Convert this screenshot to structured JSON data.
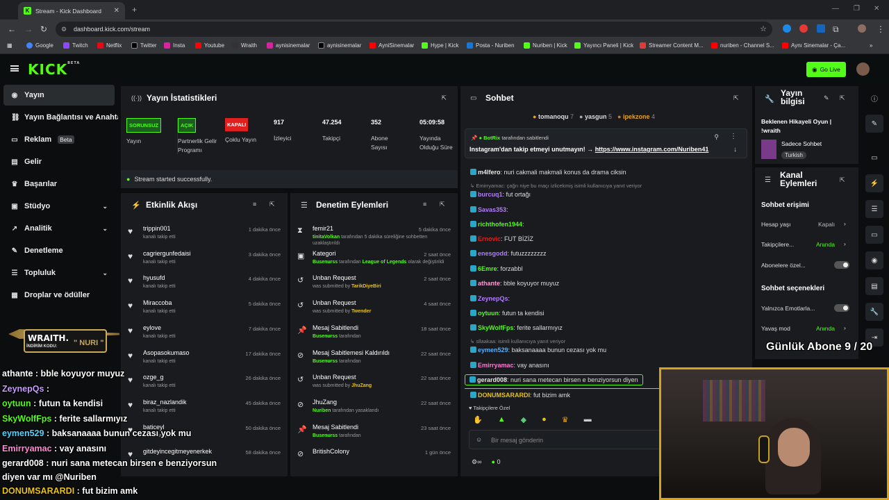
{
  "browser": {
    "tab_title": "Stream - Kick Dashboard",
    "url": "dashboard.kick.com/stream",
    "bookmarks": [
      "Google",
      "Twitch",
      "Netflix",
      "Twitter",
      "Insta",
      "Youtube",
      "Wraith",
      "aynisinemalar",
      "aynisinemalar",
      "AyniSinemalar",
      "Hype | Kick",
      "Posta - Nuriben",
      "Nuriben | Kick",
      "Yayıncı Paneli | Kick",
      "Streamer Content M...",
      "nuriben - Channel S...",
      "Aynı Sinemalar - Ça..."
    ]
  },
  "header": {
    "logo": "KICK",
    "logo_sup": "BETA",
    "go_live": "Go Live"
  },
  "sidebar": {
    "items": [
      {
        "label": "Yayın",
        "icon": "broadcast-icon"
      },
      {
        "label": "Yayın Bağlantısı ve Anahtarı",
        "icon": "link-icon"
      },
      {
        "label": "Reklam",
        "icon": "ad-icon",
        "badge": "Beta"
      },
      {
        "label": "Gelir",
        "icon": "revenue-icon"
      },
      {
        "label": "Başarılar",
        "icon": "trophy-icon"
      },
      {
        "label": "Stüdyo",
        "icon": "studio-icon"
      },
      {
        "label": "Analitik",
        "icon": "analytics-icon"
      },
      {
        "label": "Denetleme",
        "icon": "wrench-icon"
      },
      {
        "label": "Topluluk",
        "icon": "community-icon"
      },
      {
        "label": "Droplar ve ödüller",
        "icon": "gift-icon"
      }
    ]
  },
  "stats": {
    "title": "Yayın İstatistikleri",
    "badges": [
      {
        "badge": "SORUNSUZ",
        "label": "Yayın",
        "color": "#53fc18"
      },
      {
        "badge": "AÇIK",
        "label": "Partnerlik Gelir Programı",
        "color": "#53fc18"
      },
      {
        "badge": "KAPALI",
        "label": "Çoklu Yayın",
        "color": "#e0201e"
      }
    ],
    "numbers": [
      {
        "value": "917",
        "label": "İzleyici"
      },
      {
        "value": "47.254",
        "label": "Takipçi"
      },
      {
        "value": "352",
        "label": "Abone Sayısı"
      },
      {
        "value": "05:09:58",
        "label": "Yayında Olduğu Süre"
      }
    ],
    "status": "Stream started successfully."
  },
  "activity": {
    "title": "Etkinlik Akışı",
    "items": [
      {
        "name": "trippin001",
        "sub": "kanalı takip etti",
        "time": "1 dakika önce"
      },
      {
        "name": "cagriergunfedaisi",
        "sub": "kanalı takip etti",
        "time": "3 dakika önce"
      },
      {
        "name": "hyusufd",
        "sub": "kanalı takip etti",
        "time": "4 dakika önce"
      },
      {
        "name": "Miraccoba",
        "sub": "kanalı takip etti",
        "time": "5 dakika önce"
      },
      {
        "name": "eylove",
        "sub": "kanalı takip etti",
        "time": "7 dakika önce"
      },
      {
        "name": "Asopasokumaso",
        "sub": "kanalı takip etti",
        "time": "17 dakika önce"
      },
      {
        "name": "ozge_g",
        "sub": "kanalı takip etti",
        "time": "26 dakika önce"
      },
      {
        "name": "biraz_nazlandik",
        "sub": "kanalı takip etti",
        "time": "45 dakika önce"
      },
      {
        "name": "baticeyl",
        "sub": "kanalı takip etti",
        "time": "50 dakika önce"
      },
      {
        "name": "gitdeyincegitmeyenerkek",
        "sub": "",
        "time": "58 dakika önce"
      }
    ]
  },
  "moderation": {
    "title": "Denetim Eylemleri",
    "items": [
      {
        "name": "femir21",
        "time": "5 dakika önce",
        "actor": "tinitaVolkan",
        "text": " tarafından 5 dakika süreliğine sohbetten uzaklaştırıldı",
        "icon": "timeout-icon"
      },
      {
        "name": "Kategori",
        "time": "2 saat önce",
        "actor": "Busenurss",
        "text": " tarafından ",
        "extra": "League of Legends",
        "text2": " olarak değiştirildi",
        "icon": "category-icon"
      },
      {
        "name": "Unban Request",
        "time": "2 saat önce",
        "actor": "TarikDiyeBiri",
        "text": "was submitted by ",
        "icon": "unban-icon",
        "yellow": true
      },
      {
        "name": "Unban Request",
        "time": "4 saat önce",
        "actor": "Twender",
        "text": "was submitted by ",
        "icon": "unban-icon",
        "yellow": true
      },
      {
        "name": "Mesaj Sabitlendi",
        "time": "18 saat önce",
        "actor": "Busenurss",
        "text": " tarafından",
        "icon": "pin-icon"
      },
      {
        "name": "Mesaj Sabitlemesi Kaldırıldı",
        "time": "22 saat önce",
        "actor": "Busenurss",
        "text": " tarafından",
        "icon": "unpin-icon"
      },
      {
        "name": "Unban Request",
        "time": "22 saat önce",
        "actor": "JhuZang",
        "text": "was submitted by ",
        "icon": "unban-icon",
        "yellow": true
      },
      {
        "name": "JhuZang",
        "time": "22 saat önce",
        "actor": "Nuriben",
        "text": " tarafından yasaklandı",
        "icon": "ban-icon"
      },
      {
        "name": "Mesaj Sabitlendi",
        "time": "23 saat önce",
        "actor": "Busenurss",
        "text": " tarafından",
        "icon": "pin-icon"
      },
      {
        "name": "BritishColony",
        "time": "1 gün önce",
        "actor": "",
        "text": "",
        "icon": "ban-icon"
      }
    ]
  },
  "chat": {
    "title": "Sohbet",
    "top": [
      {
        "name": "tomanoqu",
        "count": "7"
      },
      {
        "name": "yasgun",
        "count": "5"
      },
      {
        "name": "ipekzone",
        "count": "4"
      }
    ],
    "pinned": {
      "by": "BotRix",
      "by_suffix": " tarafından sabitlendi",
      "text": "Instagram'dan takip etmeyi unutmayın! → ",
      "link": "https://www.instagram.com/Nuriben41"
    },
    "messages": [
      {
        "user": "m4lfero",
        "text": "nuri cakmali makmali konus da drama ciksin",
        "color": "#e7e7e7"
      },
      {
        "reply": "Emirryamac: çağrı niye bu maçı izlicekmiş isimli kullanıcıya yanıt veriyor"
      },
      {
        "user": "burcuq1",
        "text": "fut ortağı",
        "color": "#b47cff"
      },
      {
        "user": "Savas353",
        "text": "",
        "color": "#b47cff"
      },
      {
        "user": "richthofen1944",
        "text": "",
        "color": "#53fc18"
      },
      {
        "user": "Ernovic",
        "text": "FUT BİZİZ",
        "color": "#e0201e"
      },
      {
        "user": "enesgodd",
        "text": "futuzzzzzzzz",
        "color": "#b47cff"
      },
      {
        "user": "6Emre",
        "text": "forzabbl",
        "color": "#53fc18"
      },
      {
        "user": "athante",
        "text": "bble koyuyor muyuz",
        "color": "#ff9ad5"
      },
      {
        "user": "ZeynepQs",
        "text": "",
        "color": "#b47cff"
      },
      {
        "user": "oytuun",
        "text": "futun ta kendisi",
        "color": "#53fc18"
      },
      {
        "user": "SkyWolfFps",
        "text": "ferite sallarmıyız",
        "color": "#53fc18"
      },
      {
        "reply": "sllaakaa:  isimli kullanıcıya yanıt veriyor"
      },
      {
        "user": "eymen529",
        "text": "baksanaaaa bunun cezası yok mu",
        "color": "#53b0ff"
      },
      {
        "user": "Emirryamac",
        "text": "vay anasını",
        "color": "#ff7ad5"
      },
      {
        "user": "gerard008",
        "text": "nuri sana metecan birsen e benziyorsun diyen",
        "color": "#e8e8e8"
      },
      {
        "user": "DONUMSARARDI",
        "text": "fut bizim amk",
        "color": "#e8c21b"
      }
    ],
    "emote_label": "Takipçilere Özel",
    "input_placeholder": "Bir mesaj gönderin",
    "points": "0"
  },
  "stream_info": {
    "title": "Yayın bilgisi",
    "stream_title": "Beklenen Hikayeli Oyun | !wraith",
    "category": "Sadece Sohbet",
    "tag": "Turkish"
  },
  "channel_actions": {
    "title": "Kanal Eylemleri",
    "section1": "Sohbet erişimi",
    "rows1": [
      {
        "label": "Hesap yaşı",
        "value": "Kapalı"
      },
      {
        "label": "Takipçilere...",
        "value": "Anında"
      },
      {
        "label": "Abonelere özel...",
        "value": ""
      }
    ],
    "section2": "Sohbet seçenekleri",
    "rows2": [
      {
        "label": "Yalnızca Emotlarla...",
        "value": ""
      },
      {
        "label": "Yavaş mod",
        "value": "Anında"
      }
    ]
  },
  "overlay": {
    "sub_goal": "Günlük Abone 9 / 20",
    "wraith_brand": "WRAITH.",
    "wraith_code_label": "İNDİRİM KODU:",
    "wraith_code": "\" NURI \"",
    "chat": [
      {
        "user": "athante",
        "text": " : bble koyuyor muyuz",
        "color": "#ffffff"
      },
      {
        "user": "ZeynepQs",
        "text": " : ",
        "color": "#c89bff"
      },
      {
        "user": "oytuun",
        "text": " : futun ta kendisi",
        "color": "#53fc18"
      },
      {
        "user": "SkyWolfFps",
        "text": " : ferite sallarmıyız",
        "color": "#53fc18"
      },
      {
        "user": "eymen529",
        "text": " : baksanaaaa bunun cezası yok mu",
        "color": "#53d4ff"
      },
      {
        "user": "Emirryamac",
        "text": " : vay anasını",
        "color": "#ff8ad5"
      },
      {
        "user": "gerard008",
        "text": " : nuri sana metecan birsen e benziyorsun",
        "color": "#ffffff"
      },
      {
        "user": "diyen var mı",
        "text": " @Nuriben",
        "color": "#ffffff"
      },
      {
        "user": "DONUMSARARDI",
        "text": " : fut bizim amk",
        "color": "#e8c21b"
      }
    ]
  },
  "colors": {
    "accent": "#53fc18",
    "panel": "#191b1f",
    "bg": "#0b0d0f",
    "danger": "#e0201e"
  }
}
